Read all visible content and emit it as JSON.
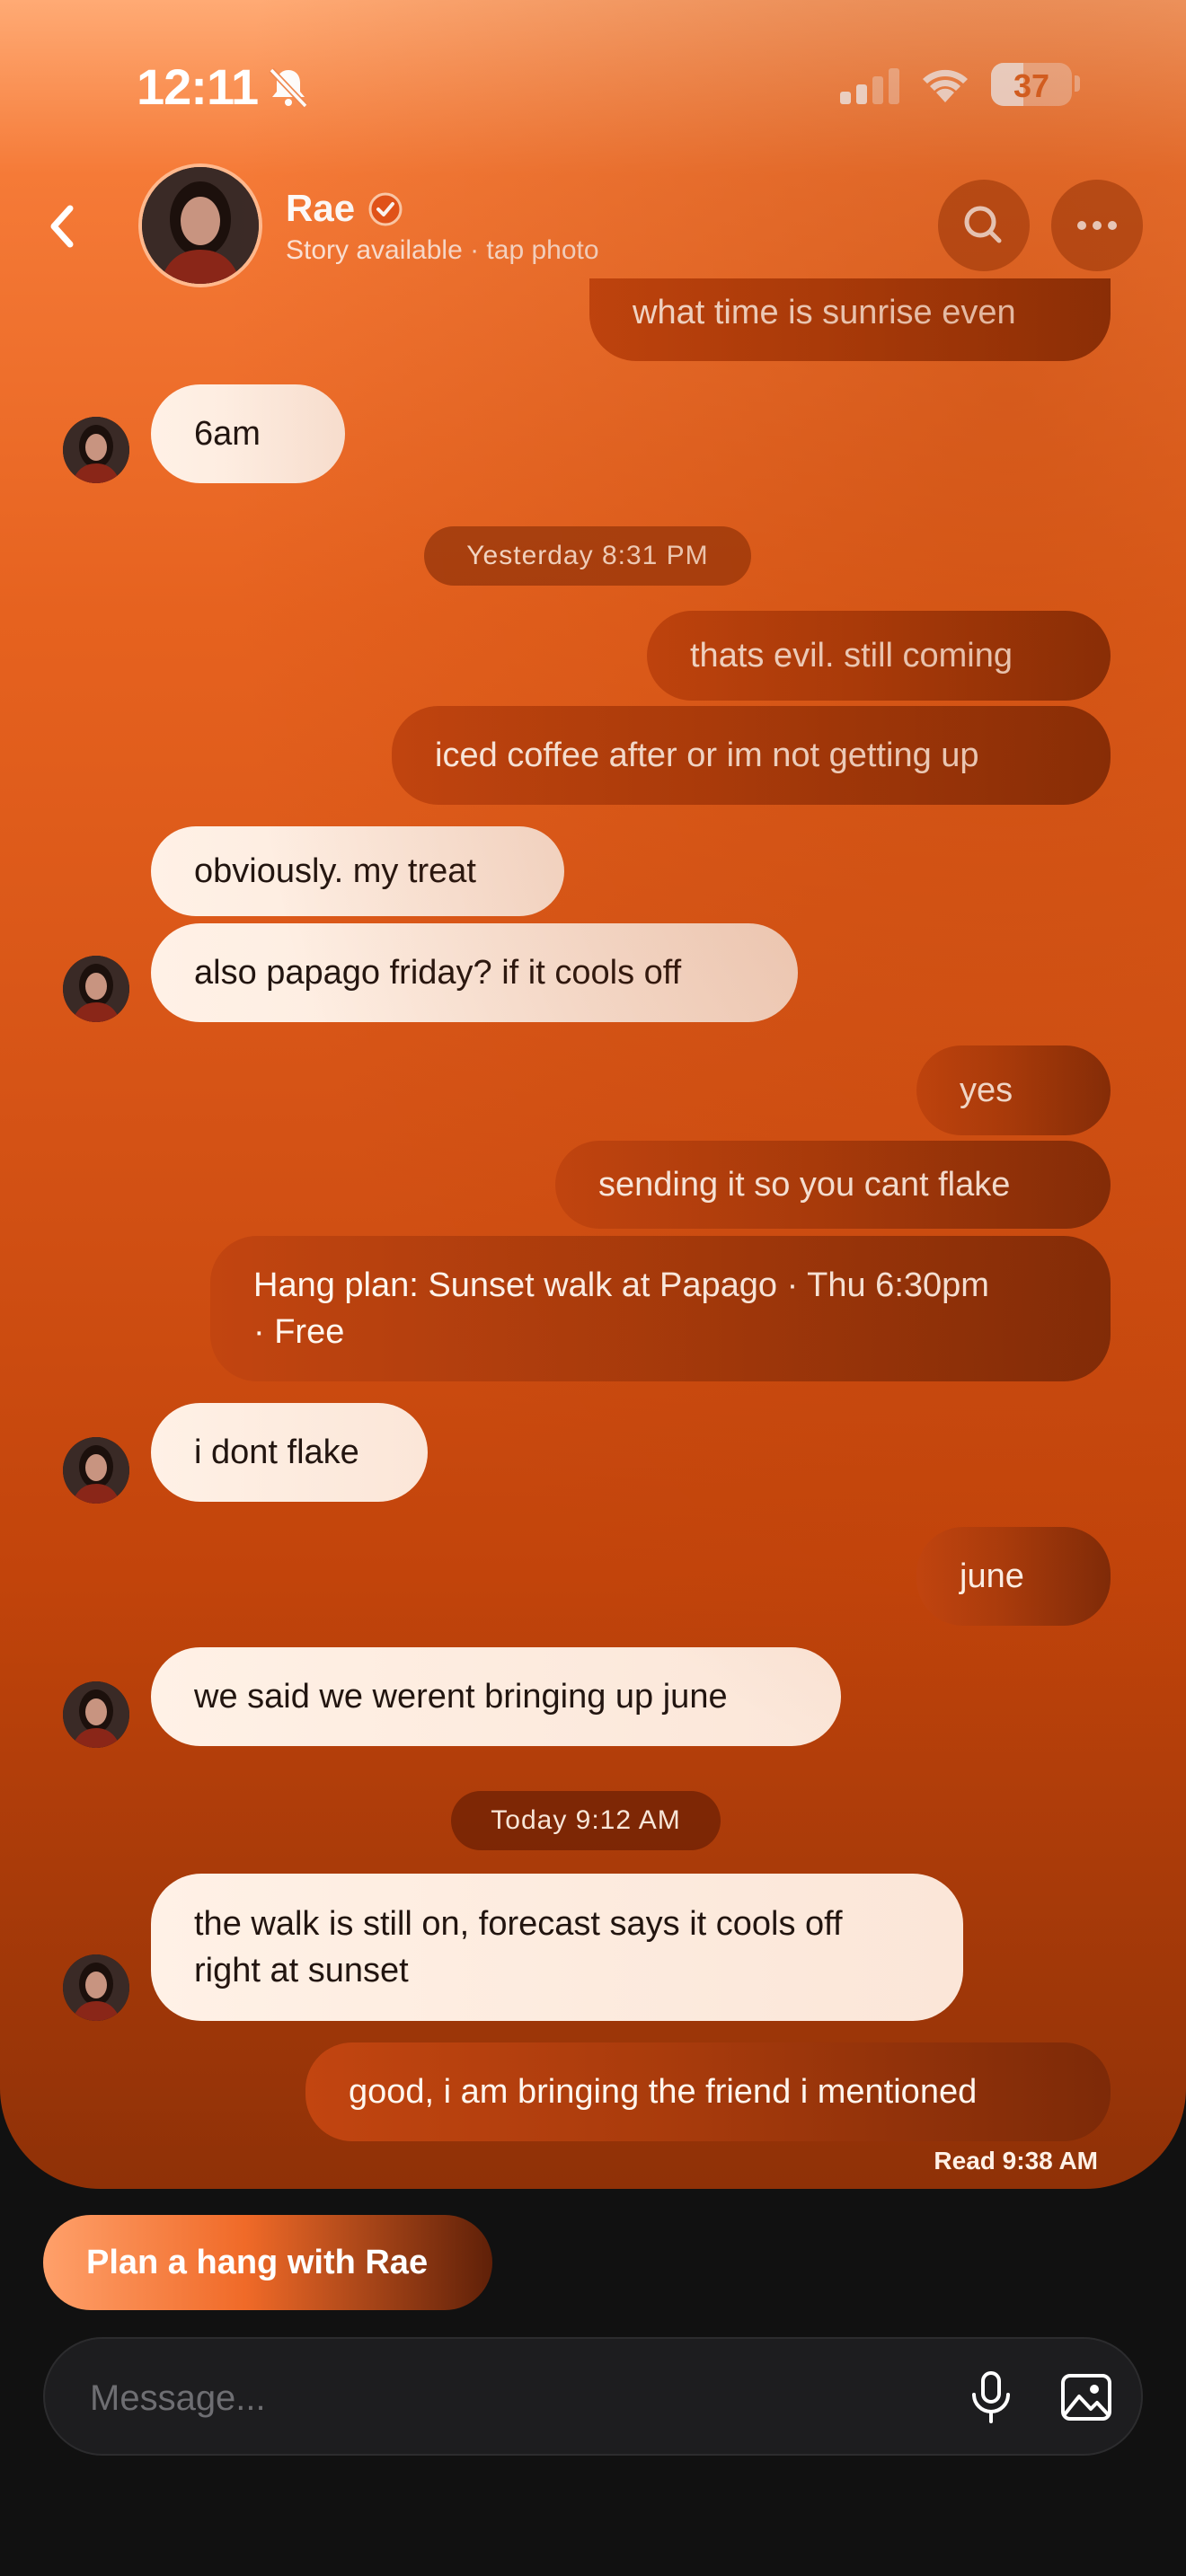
{
  "status_bar": {
    "time": "12:11",
    "battery": "37"
  },
  "header": {
    "contact_name": "Rae",
    "subtitle": "Story available · tap photo"
  },
  "messages": [
    {
      "id": "m0",
      "direction": "out",
      "text": "what time is sunrise even"
    },
    {
      "id": "m1",
      "direction": "in",
      "text": "6am"
    },
    {
      "id": "ts1",
      "type": "timestamp",
      "text": "Yesterday 8:31 PM"
    },
    {
      "id": "m2",
      "direction": "out",
      "text": "thats evil. still coming"
    },
    {
      "id": "m3",
      "direction": "out",
      "text": "iced coffee after or im not getting up"
    },
    {
      "id": "m4",
      "direction": "in",
      "text": "obviously. my treat"
    },
    {
      "id": "m5",
      "direction": "in",
      "text": "also papago friday? if it cools off"
    },
    {
      "id": "m6",
      "direction": "out",
      "text": "yes"
    },
    {
      "id": "m7",
      "direction": "out",
      "text": "sending it so you cant flake"
    },
    {
      "id": "m8",
      "direction": "out",
      "text": "Hang plan: Sunset walk at Papago · Thu 6:30pm · Free"
    },
    {
      "id": "m9",
      "direction": "in",
      "text": "i dont flake"
    },
    {
      "id": "m10",
      "direction": "out",
      "text": "june"
    },
    {
      "id": "m11",
      "direction": "in",
      "text": "we said we werent bringing up june"
    },
    {
      "id": "ts2",
      "type": "timestamp",
      "text": "Today 9:12 AM"
    },
    {
      "id": "m12",
      "direction": "in",
      "text": "the walk is still on, forecast says it cools off right at sunset"
    },
    {
      "id": "m13",
      "direction": "out",
      "text": "good, i am bringing the friend i mentioned"
    }
  ],
  "read_receipt": "Read 9:38 AM",
  "plan_button_label": "Plan a hang with Rae",
  "composer": {
    "placeholder": "Message..."
  },
  "colors": {
    "accent": "#e4541a",
    "incoming_bubble": "#fdeadc",
    "outgoing_bubble": "#a93b0c",
    "background_dark": "#111111"
  },
  "icons": [
    "back-chevron-icon",
    "bell-slash-icon",
    "signal-icon",
    "wifi-icon",
    "battery-icon",
    "verified-check-icon",
    "search-icon",
    "more-dots-icon",
    "microphone-icon",
    "image-icon"
  ]
}
